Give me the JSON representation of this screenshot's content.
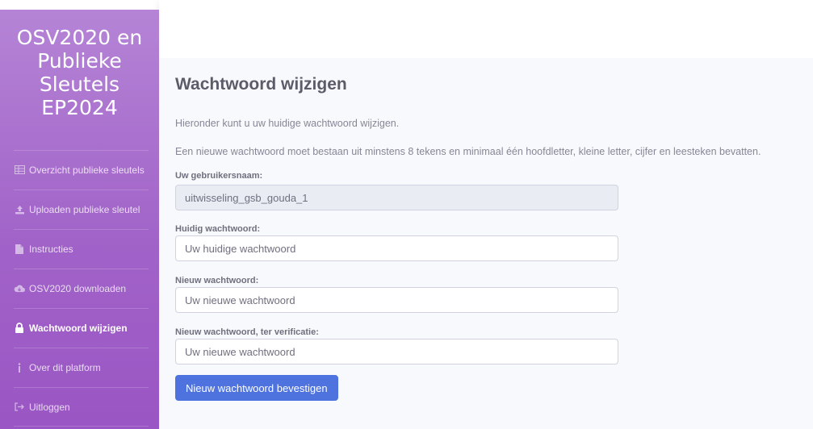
{
  "brand": {
    "line1": "OSV2020 en",
    "line2": "Publieke",
    "line3": "Sleutels",
    "line4": "EP2024"
  },
  "nav": [
    {
      "label": "Overzicht publieke sleutels",
      "icon": "table-icon"
    },
    {
      "label": "Uploaden publieke sleutel",
      "icon": "upload-icon"
    },
    {
      "label": "Instructies",
      "icon": "file-icon"
    },
    {
      "label": "OSV2020 downloaden",
      "icon": "cloud-download-icon"
    },
    {
      "label": "Wachtwoord wijzigen",
      "icon": "lock-icon",
      "active": true
    },
    {
      "label": "Over dit platform",
      "icon": "info-icon"
    },
    {
      "label": "Uitloggen",
      "icon": "sign-out-icon"
    }
  ],
  "page": {
    "title": "Wachtwoord wijzigen",
    "intro": "Hieronder kunt u uw huidige wachtwoord wijzigen.",
    "requirements": "Een nieuwe wachtwoord moet bestaan uit minstens 8 tekens en minimaal één hoofdletter, kleine letter, cijfer en leesteken bevatten."
  },
  "form": {
    "username_label": "Uw gebruikersnaam:",
    "username_value": "uitwisseling_gsb_gouda_1",
    "current_label": "Huidig wachtwoord:",
    "current_placeholder": "Uw huidige wachtwoord",
    "new_label": "Nieuw wachtwoord:",
    "new_placeholder": "Uw nieuwe wachtwoord",
    "verify_label": "Nieuw wachtwoord, ter verificatie:",
    "verify_placeholder": "Uw nieuwe wachtwoord",
    "submit_label": "Nieuw wachtwoord bevestigen"
  },
  "colors": {
    "sidebar": "#a163c8",
    "primary": "#4e73df",
    "background": "#f8f9fc"
  }
}
